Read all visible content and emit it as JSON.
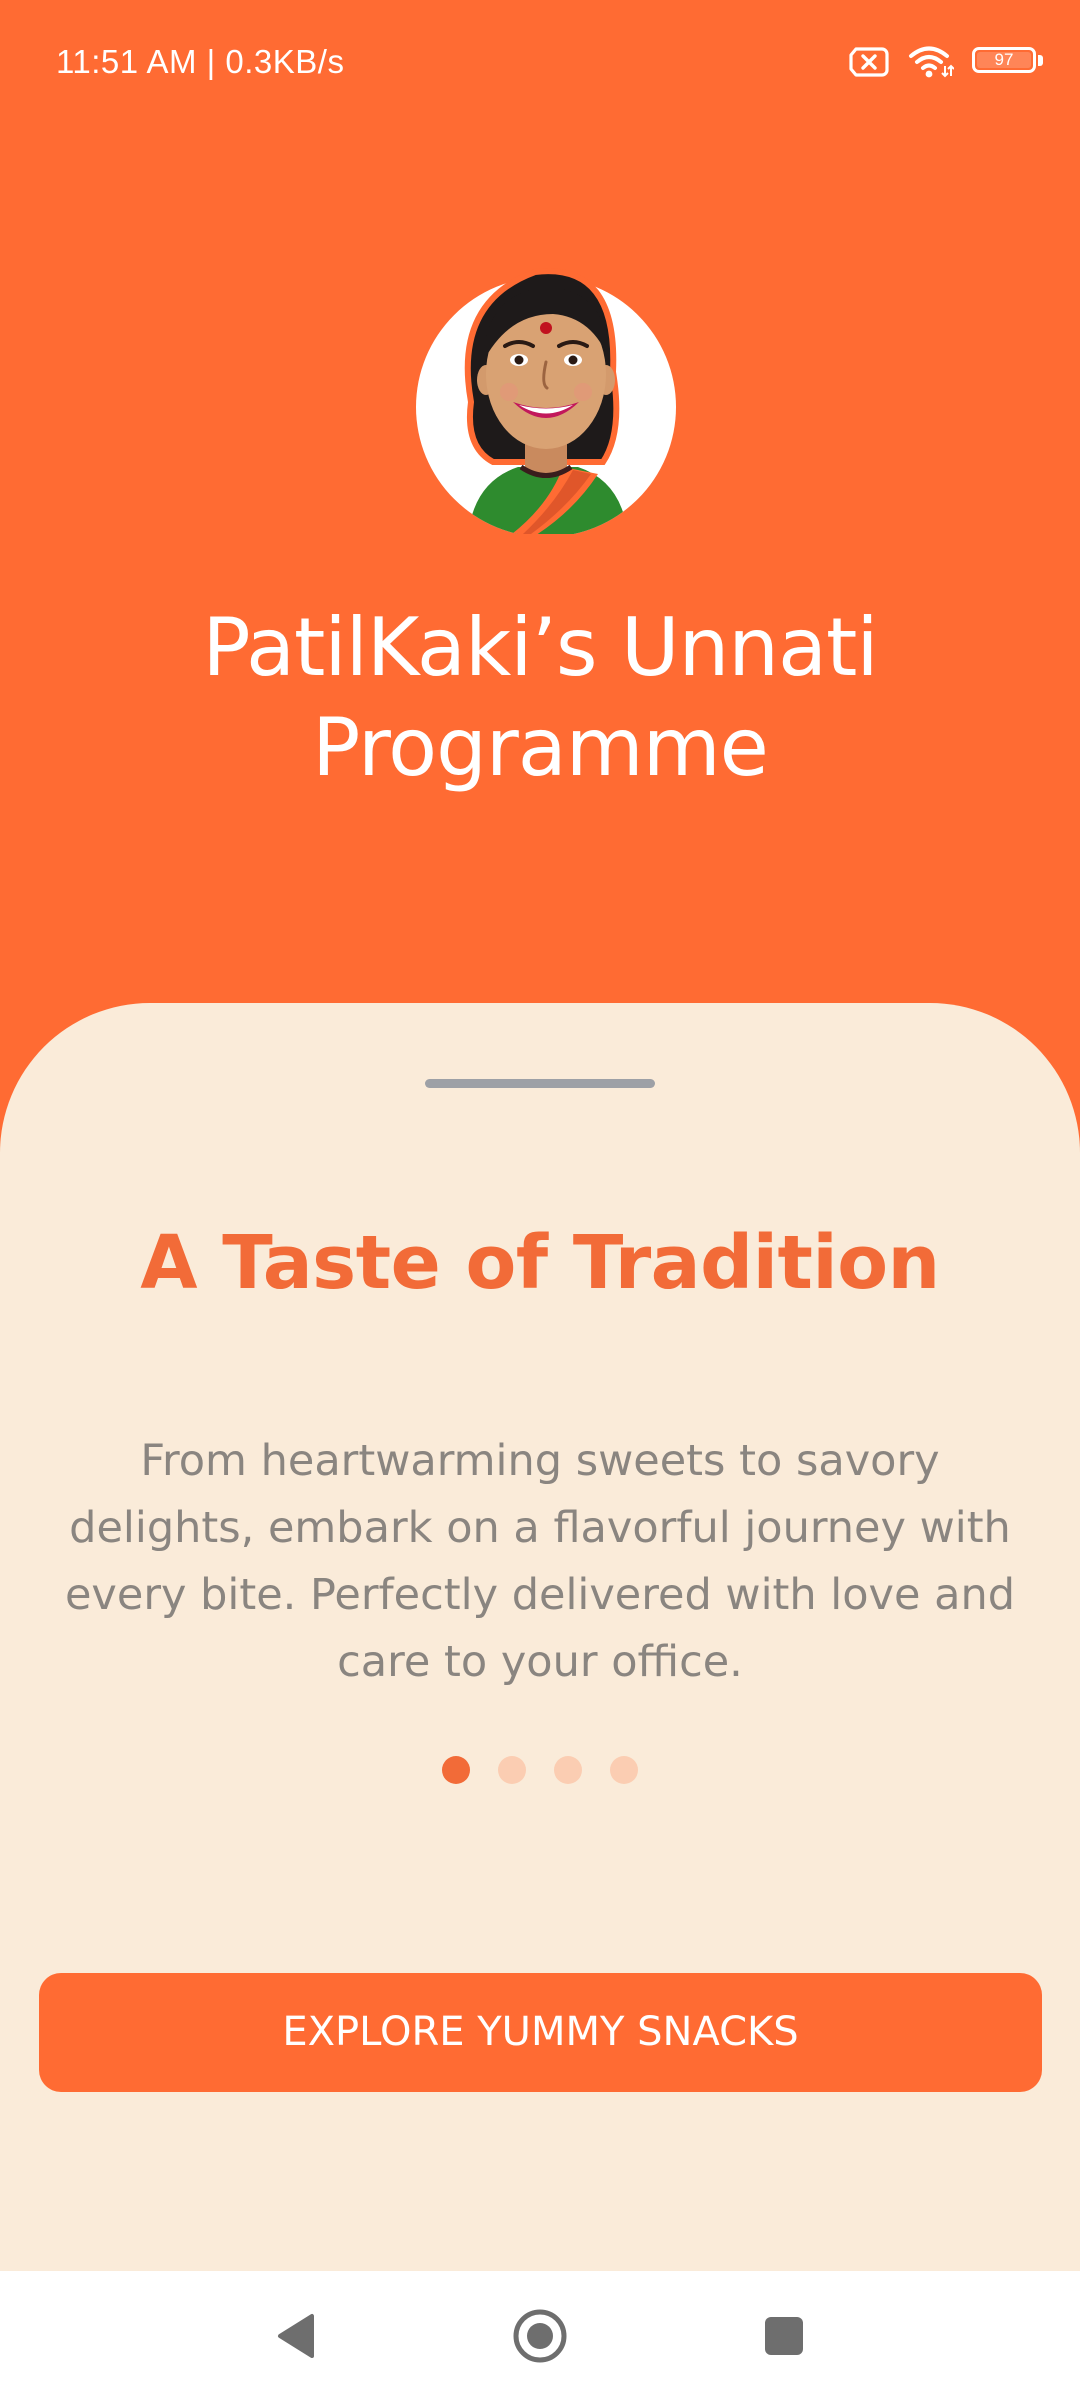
{
  "status_bar": {
    "time_speed": "11:51 AM | 0.3KB/s",
    "battery_level": "97",
    "icons": [
      "no-sim-icon",
      "wifi-icon",
      "battery-icon"
    ]
  },
  "header": {
    "logo_icon": "patilkaki-avatar-icon",
    "title": "PatilKaki’s Unnati Programme"
  },
  "onboarding": {
    "heading": "A Taste of Tradition",
    "description": "From heartwarming sweets to savory delights, embark on a flavorful journey with every bite. Perfectly delivered with love and care to your office.",
    "pages_total": 4,
    "active_page": 1,
    "cta_label": "EXPLORE YUMMY SNACKS"
  },
  "navigation_bar": {
    "buttons": [
      "back-icon",
      "home-icon",
      "recents-icon"
    ]
  },
  "colors": {
    "brand_orange": "#FF6B33",
    "heading_orange": "#F26B38",
    "sheet_background": "#FAEBD9",
    "text_gray": "#8A8580",
    "dot_inactive": "#FBCDB2"
  }
}
